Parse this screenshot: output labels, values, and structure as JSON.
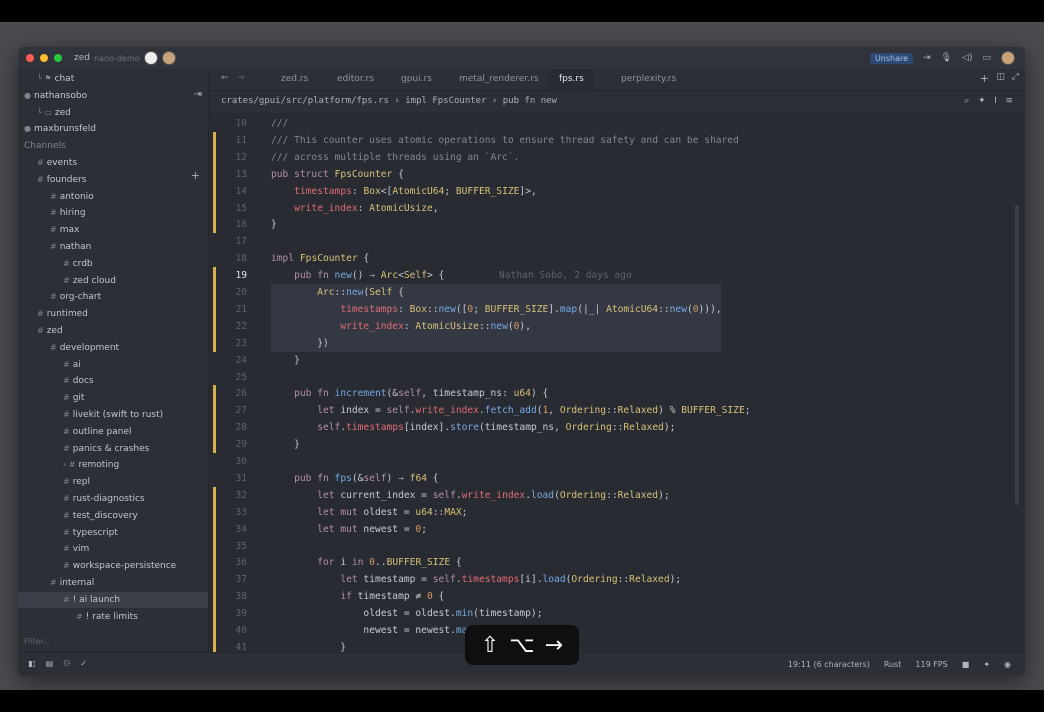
{
  "window": {
    "app_name": "zed",
    "project": "nano-demo",
    "unshare_label": "Unshare"
  },
  "sidebar": {
    "rows": [
      {
        "label": "chat",
        "indent": 1,
        "prefix": "└ ⚑"
      },
      {
        "label": "nathansobo",
        "indent": 0,
        "prefix": "●"
      },
      {
        "label": "zed",
        "indent": 1,
        "prefix": "└ ▭"
      },
      {
        "label": "maxbrunsfeld",
        "indent": 0,
        "prefix": "●"
      },
      {
        "label": "Channels",
        "indent": 0,
        "prefix": "",
        "head": true
      },
      {
        "label": "events",
        "indent": 1,
        "prefix": "#"
      },
      {
        "label": "founders",
        "indent": 1,
        "prefix": "#"
      },
      {
        "label": "antonio",
        "indent": 2,
        "prefix": "#"
      },
      {
        "label": "hiring",
        "indent": 2,
        "prefix": "#"
      },
      {
        "label": "max",
        "indent": 2,
        "prefix": "#"
      },
      {
        "label": "nathan",
        "indent": 2,
        "prefix": "#"
      },
      {
        "label": "crdb",
        "indent": 3,
        "prefix": "#"
      },
      {
        "label": "zed cloud",
        "indent": 3,
        "prefix": "#"
      },
      {
        "label": "org-chart",
        "indent": 2,
        "prefix": "#"
      },
      {
        "label": "runtimed",
        "indent": 1,
        "prefix": "#"
      },
      {
        "label": "zed",
        "indent": 1,
        "prefix": "#"
      },
      {
        "label": "development",
        "indent": 2,
        "prefix": "#"
      },
      {
        "label": "ai",
        "indent": 3,
        "prefix": "#"
      },
      {
        "label": "docs",
        "indent": 3,
        "prefix": "#"
      },
      {
        "label": "git",
        "indent": 3,
        "prefix": "#"
      },
      {
        "label": "livekit (swift to rust)",
        "indent": 3,
        "prefix": "#"
      },
      {
        "label": "outline panel",
        "indent": 3,
        "prefix": "#"
      },
      {
        "label": "panics & crashes",
        "indent": 3,
        "prefix": "#"
      },
      {
        "label": "remoting",
        "indent": 3,
        "prefix": "› #"
      },
      {
        "label": "repl",
        "indent": 3,
        "prefix": "#"
      },
      {
        "label": "rust-diagnostics",
        "indent": 3,
        "prefix": "#"
      },
      {
        "label": "test_discovery",
        "indent": 3,
        "prefix": "#"
      },
      {
        "label": "typescript",
        "indent": 3,
        "prefix": "#"
      },
      {
        "label": "vim",
        "indent": 3,
        "prefix": "#"
      },
      {
        "label": "workspace-persistence",
        "indent": 3,
        "prefix": "#"
      },
      {
        "label": "internal",
        "indent": 2,
        "prefix": "#"
      },
      {
        "label": "! ai launch",
        "indent": 3,
        "prefix": "#",
        "selected": true
      },
      {
        "label": "! rate limits",
        "indent": 4,
        "prefix": "#"
      }
    ],
    "filter_placeholder": "Filter..."
  },
  "tabs": [
    "zed.rs",
    "editor.rs",
    "gpui.rs",
    "metal_renderer.rs",
    "fps.rs",
    "perplexity.rs"
  ],
  "active_tab": "fps.rs",
  "breadcrumb": "crates/gpui/src/platform/fps.rs › impl FpsCounter › pub fn new",
  "editor": {
    "current_line": 19,
    "blame": "Nathan Sobo, 2 days ago",
    "lines": [
      {
        "n": 10,
        "html": "<span class='cm'>///</span>"
      },
      {
        "n": 11,
        "html": "<span class='cm'>/// This counter uses atomic operations to ensure thread safety and can be shared</span>"
      },
      {
        "n": 12,
        "html": "<span class='cm'>/// across multiple threads using an `Arc`.</span>"
      },
      {
        "n": 13,
        "html": "<span class='kw'>pub struct</span> <span class='ty'>FpsCounter</span> {"
      },
      {
        "n": 14,
        "html": "    <span class='fd'>timestamps</span>: <span class='ty'>Box</span>&lt;[<span class='ty'>AtomicU64</span>; <span class='ty'>BUFFER_SIZE</span>]&gt;,"
      },
      {
        "n": 15,
        "html": "    <span class='fd'>write_index</span>: <span class='ty'>AtomicUsize</span>,"
      },
      {
        "n": 16,
        "html": "}"
      },
      {
        "n": 17,
        "html": ""
      },
      {
        "n": 18,
        "html": "<span class='kw'>impl</span> <span class='ty'>FpsCounter</span> {"
      },
      {
        "n": 19,
        "html": "    <span class='kw'>pub fn</span> <span class='fn'>new</span>() <span class='op'>→</span> <span class='ty'>Arc</span>&lt;<span class='ty'>Self</span>&gt; {"
      },
      {
        "n": 20,
        "html": "        <span class='ty'>Arc</span>::<span class='fn'>new</span>(<span class='ty'>Self</span> {"
      },
      {
        "n": 21,
        "html": "            <span class='fd'>timestamps</span>: <span class='ty'>Box</span>::<span class='fn'>new</span>([<span class='nm'>0</span>; <span class='ty'>BUFFER_SIZE</span>].<span class='fn'>map</span>(|_| <span class='ty'>AtomicU64</span>::<span class='fn'>new</span>(<span class='nm'>0</span>))),"
      },
      {
        "n": 22,
        "html": "            <span class='fd'>write_index</span>: <span class='ty'>AtomicUsize</span>::<span class='fn'>new</span>(<span class='nm'>0</span>),"
      },
      {
        "n": 23,
        "html": "        })"
      },
      {
        "n": 24,
        "html": "    }"
      },
      {
        "n": 25,
        "html": ""
      },
      {
        "n": 26,
        "html": "    <span class='kw'>pub fn</span> <span class='fn'>increment</span>(&amp;<span class='kw'>self</span>, timestamp_ns: <span class='ty'>u64</span>) {"
      },
      {
        "n": 27,
        "html": "        <span class='kw'>let</span> index = <span class='kw'>self</span>.<span class='fd'>write_index</span>.<span class='fn'>fetch_add</span>(<span class='nm'>1</span>, <span class='ty'>Ordering</span>::<span class='ty'>Relaxed</span>) % <span class='ty'>BUFFER_SIZE</span>;"
      },
      {
        "n": 28,
        "html": "        <span class='kw'>self</span>.<span class='fd'>timestamps</span>[index].<span class='fn'>store</span>(timestamp_ns, <span class='ty'>Ordering</span>::<span class='ty'>Relaxed</span>);"
      },
      {
        "n": 29,
        "html": "    }"
      },
      {
        "n": 30,
        "html": ""
      },
      {
        "n": 31,
        "html": "    <span class='kw'>pub fn</span> <span class='fn'>fps</span>(&amp;<span class='kw'>self</span>) <span class='op'>→</span> <span class='ty'>f64</span> {"
      },
      {
        "n": 32,
        "html": "        <span class='kw'>let</span> current_index = <span class='kw'>self</span>.<span class='fd'>write_index</span>.<span class='fn'>load</span>(<span class='ty'>Ordering</span>::<span class='ty'>Relaxed</span>);"
      },
      {
        "n": 33,
        "html": "        <span class='kw'>let mut</span> oldest = <span class='ty'>u64</span>::<span class='ty'>MAX</span>;"
      },
      {
        "n": 34,
        "html": "        <span class='kw'>let mut</span> newest = <span class='nm'>0</span>;"
      },
      {
        "n": 35,
        "html": ""
      },
      {
        "n": 36,
        "html": "        <span class='kw'>for</span> i <span class='kw'>in</span> <span class='nm'>0</span>..<span class='ty'>BUFFER_SIZE</span> {"
      },
      {
        "n": 37,
        "html": "            <span class='kw'>let</span> timestamp = <span class='kw'>self</span>.<span class='fd'>timestamps</span>[i].<span class='fn'>load</span>(<span class='ty'>Ordering</span>::<span class='ty'>Relaxed</span>);"
      },
      {
        "n": 38,
        "html": "            <span class='kw'>if</span> timestamp ≠ <span class='nm'>0</span> {"
      },
      {
        "n": 39,
        "html": "                oldest = oldest.<span class='fn'>min</span>(timestamp);"
      },
      {
        "n": 40,
        "html": "                newest = newest.<span class='fn'>max</span>(timestamp);"
      },
      {
        "n": 41,
        "html": "            }"
      }
    ]
  },
  "statusbar": {
    "cursor": "19:11 (6 characters)",
    "language": "Rust",
    "fps": "119 FPS"
  },
  "keystroke": {
    "keys": [
      "⇧",
      "⌥",
      "→"
    ]
  }
}
